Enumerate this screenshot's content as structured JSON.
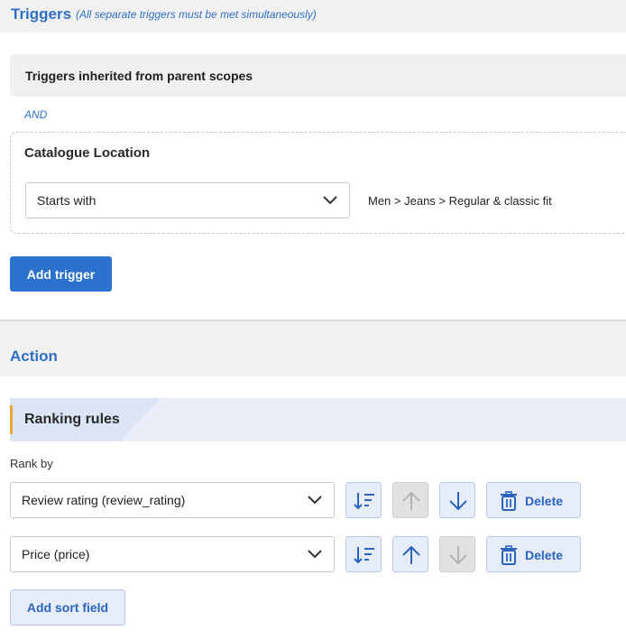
{
  "triggers": {
    "title": "Triggers",
    "note": "(All separate triggers must be met simultaneously)",
    "inherited_title": "Triggers inherited from parent scopes",
    "and_label": "AND",
    "items": [
      {
        "title": "Catalogue Location",
        "operator": "Starts with",
        "value": "Men > Jeans > Regular & classic fit"
      }
    ],
    "add_button": "Add trigger"
  },
  "action": {
    "title": "Action",
    "ranking_title": "Ranking rules",
    "rank_by_label": "Rank by",
    "sort_fields": [
      {
        "field": "Review rating (review_rating)",
        "direction": "descending"
      },
      {
        "field": "Price (price)",
        "direction": "ascending"
      }
    ],
    "delete_label": "Delete",
    "add_sort_label": "Add sort field"
  },
  "colors": {
    "accent_blue": "#2f6fc6",
    "primary_button": "#2b72cf",
    "ranking_accent": "#f0a43b"
  }
}
